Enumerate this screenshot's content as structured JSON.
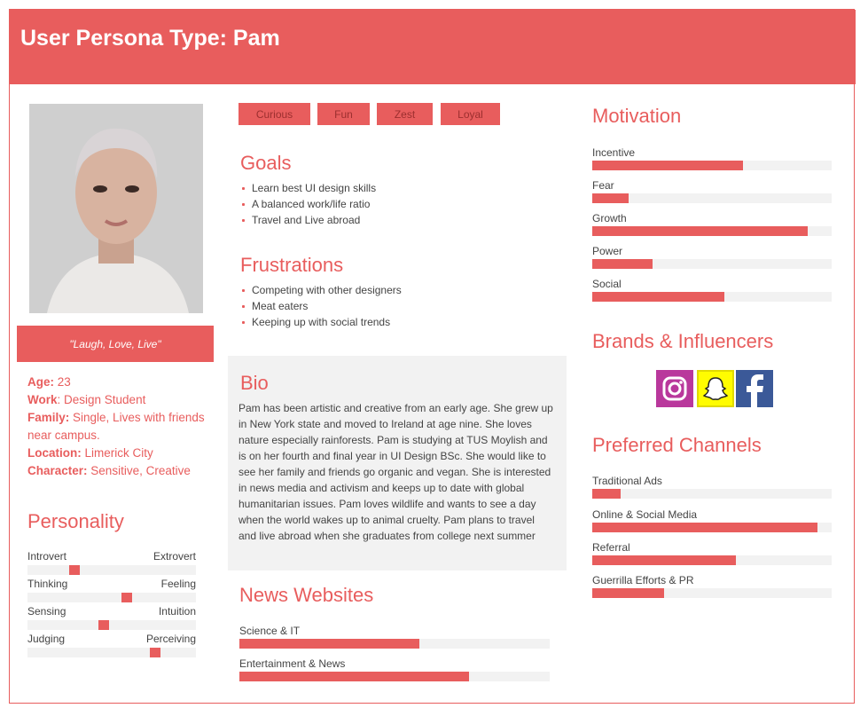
{
  "header": {
    "title": "User Persona Type: Pam"
  },
  "profile": {
    "quote": "\"Laugh, Love, Live\"",
    "age_label": "Age:",
    "age_value": "23",
    "work_label": "Work",
    "work_value": ": Design Student",
    "family_label": "Family:",
    "family_value": "Single, Lives with friends near campus.",
    "location_label": "Location:",
    "location_value": "Limerick City",
    "character_label": "Character:",
    "character_value": "Sensitive, Creative"
  },
  "personality": {
    "title": "Personality",
    "scales": [
      {
        "left": "Introvert",
        "right": "Extrovert",
        "value": 0.28
      },
      {
        "left": "Thinking",
        "right": "Feeling",
        "value": 0.59
      },
      {
        "left": "Sensing",
        "right": "Intuition",
        "value": 0.45
      },
      {
        "left": "Judging",
        "right": "Perceiving",
        "value": 0.76
      }
    ]
  },
  "tags": [
    "Curious",
    "Fun",
    "Zest",
    "Loyal"
  ],
  "goals": {
    "title": "Goals",
    "items": [
      "Learn best UI design skills",
      "A balanced work/life ratio",
      "Travel and Live abroad"
    ]
  },
  "frustrations": {
    "title": "Frustrations",
    "items": [
      "Competing with other designers",
      "Meat eaters",
      "Keeping up with social trends"
    ]
  },
  "bio": {
    "title": "Bio",
    "text": "Pam has been artistic and creative from an early age. She grew up in New York state and moved to Ireland at age nine. She loves nature especially rainforests. Pam is studying at TUS Moylish and is on her fourth and final year in UI Design BSc. She would like to see her family and friends go organic and vegan. She is interested in news media and activism and keeps up to date with global humanitarian issues. Pam loves wildlife and wants to see a day when the world wakes up to animal cruelty. Pam plans to travel and live abroad when she graduates from college next summer"
  },
  "news": {
    "title": "News Websites",
    "items": [
      {
        "label": "Science & IT",
        "value": 0.58
      },
      {
        "label": "Entertainment & News",
        "value": 0.74
      }
    ]
  },
  "motivation": {
    "title": "Motivation",
    "items": [
      {
        "label": "Incentive",
        "value": 0.63
      },
      {
        "label": "Fear",
        "value": 0.15
      },
      {
        "label": "Growth",
        "value": 0.9
      },
      {
        "label": "Power",
        "value": 0.25
      },
      {
        "label": "Social",
        "value": 0.55
      }
    ]
  },
  "brands": {
    "title": "Brands & Influencers",
    "icons": [
      "instagram-icon",
      "snapchat-icon",
      "facebook-icon"
    ],
    "colors": {
      "instagram": "#b9389c",
      "snapchat": "#fffc00",
      "facebook": "#3b5998"
    }
  },
  "channels": {
    "title": "Preferred Channels",
    "items": [
      {
        "label": "Traditional Ads",
        "value": 0.12
      },
      {
        "label": "Online & Social Media",
        "value": 0.94
      },
      {
        "label": "Referral",
        "value": 0.6
      },
      {
        "label": "Guerrilla Efforts & PR",
        "value": 0.3
      }
    ]
  },
  "colors": {
    "accent": "#e85d5d",
    "track": "#f2f2f2",
    "text": "#444444"
  }
}
